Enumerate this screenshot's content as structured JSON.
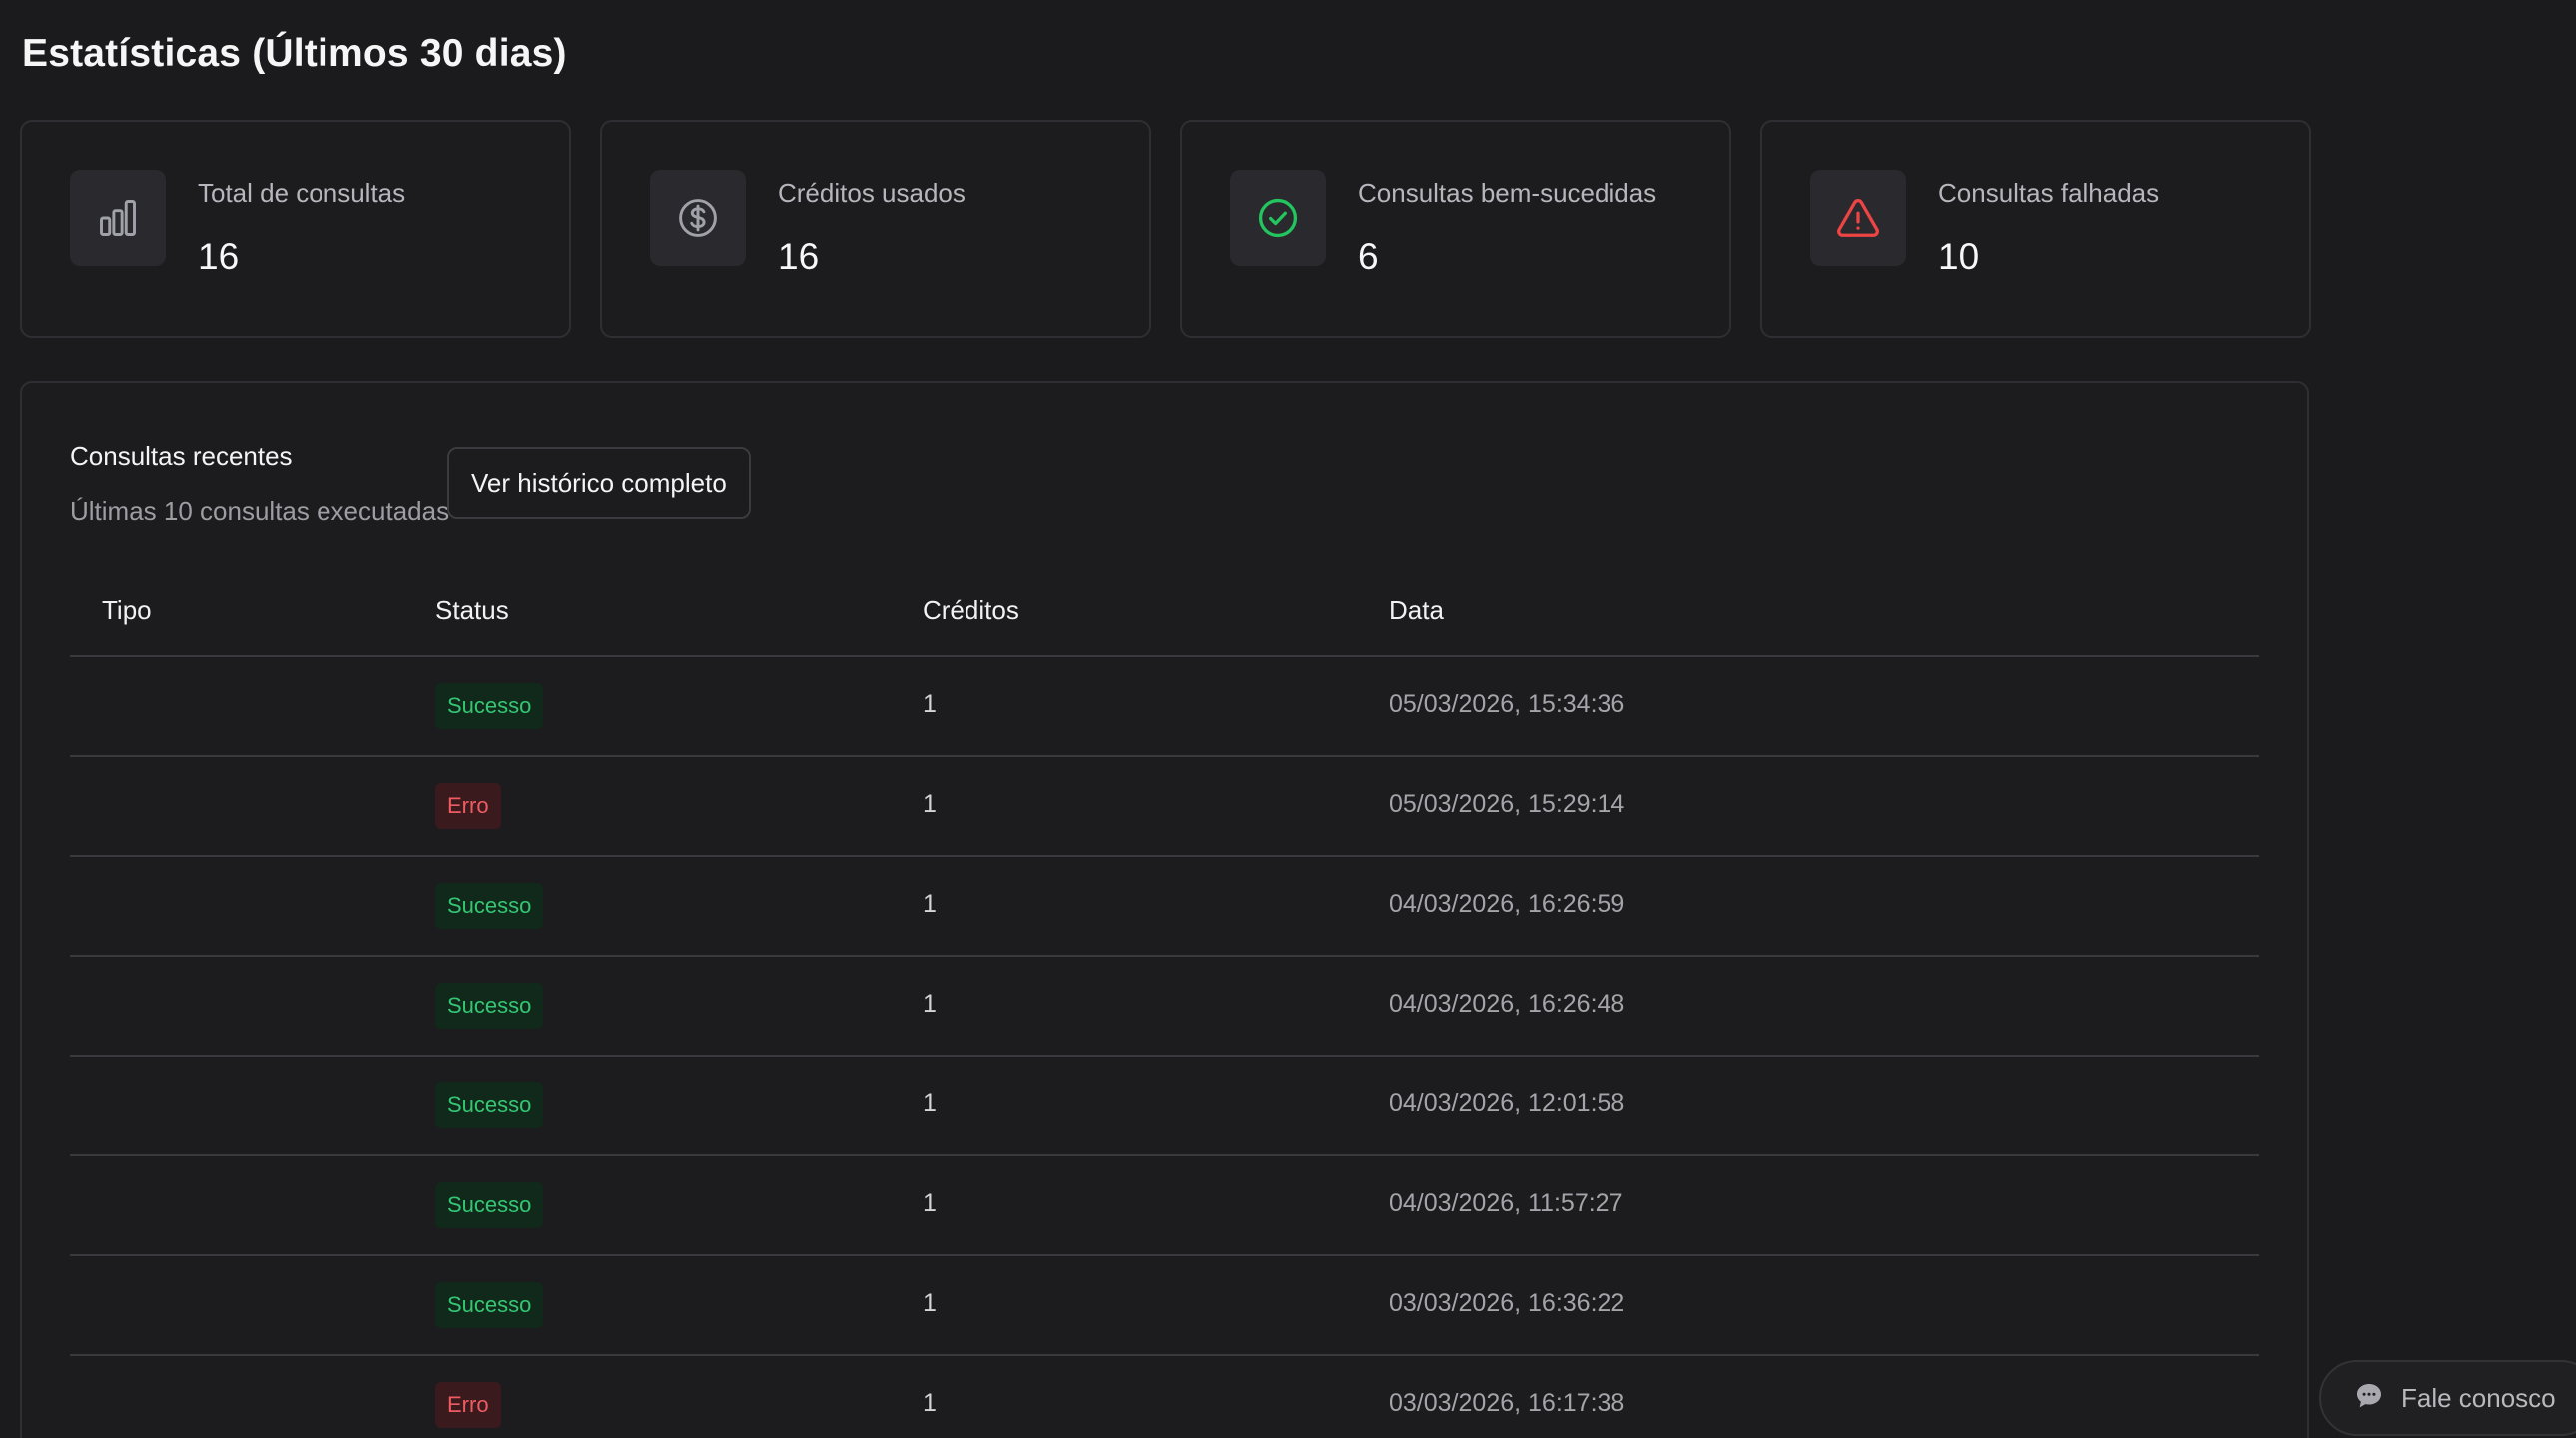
{
  "page": {
    "title": "Estatísticas (Últimos 30 dias)"
  },
  "stats": [
    {
      "label": "Total de consultas",
      "value": "16",
      "icon": "bar-chart-icon",
      "color": "#a1a1aa"
    },
    {
      "label": "Créditos usados",
      "value": "16",
      "icon": "dollar-circle-icon",
      "color": "#a1a1aa"
    },
    {
      "label": "Consultas bem-sucedidas",
      "value": "6",
      "icon": "check-circle-icon",
      "color": "#22c55e"
    },
    {
      "label": "Consultas falhadas",
      "value": "10",
      "icon": "alert-triangle-icon",
      "color": "#ef4444"
    }
  ],
  "recent": {
    "title": "Consultas recentes",
    "subtitle": "Últimas 10 consultas executadas",
    "history_button": "Ver histórico completo",
    "columns": [
      "Tipo",
      "Status",
      "Créditos",
      "Data"
    ],
    "rows": [
      {
        "tipo": "",
        "status": "Sucesso",
        "status_kind": "success",
        "creditos": "1",
        "data": "05/03/2026, 15:34:36"
      },
      {
        "tipo": "",
        "status": "Erro",
        "status_kind": "error",
        "creditos": "1",
        "data": "05/03/2026, 15:29:14"
      },
      {
        "tipo": "",
        "status": "Sucesso",
        "status_kind": "success",
        "creditos": "1",
        "data": "04/03/2026, 16:26:59"
      },
      {
        "tipo": "",
        "status": "Sucesso",
        "status_kind": "success",
        "creditos": "1",
        "data": "04/03/2026, 16:26:48"
      },
      {
        "tipo": "",
        "status": "Sucesso",
        "status_kind": "success",
        "creditos": "1",
        "data": "04/03/2026, 12:01:58"
      },
      {
        "tipo": "",
        "status": "Sucesso",
        "status_kind": "success",
        "creditos": "1",
        "data": "04/03/2026, 11:57:27"
      },
      {
        "tipo": "",
        "status": "Sucesso",
        "status_kind": "success",
        "creditos": "1",
        "data": "03/03/2026, 16:36:22"
      },
      {
        "tipo": "",
        "status": "Erro",
        "status_kind": "error",
        "creditos": "1",
        "data": "03/03/2026, 16:17:38"
      }
    ]
  },
  "chat": {
    "label": "Fale conosco",
    "icon": "chat-bubble-icon"
  }
}
